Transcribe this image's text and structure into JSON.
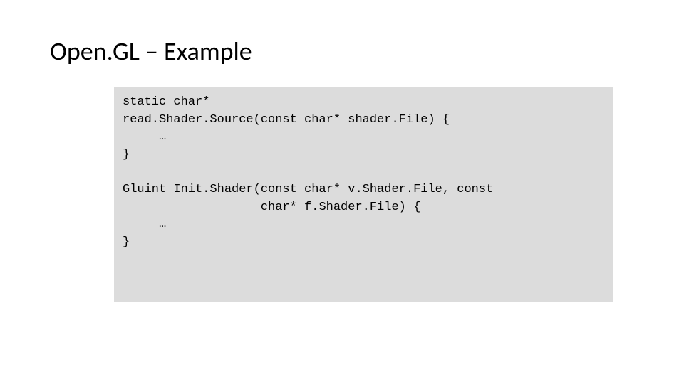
{
  "slide": {
    "title": "Open.GL – Example",
    "code": {
      "l1": "static char*",
      "l2": "read.Shader.Source(const char* shader.File) {",
      "l3": "     …",
      "l4": "}",
      "l5": "",
      "l6": "Gluint Init.Shader(const char* v.Shader.File, const",
      "l7": "                   char* f.Shader.File) {",
      "l8": "     …",
      "l9": "}"
    }
  }
}
